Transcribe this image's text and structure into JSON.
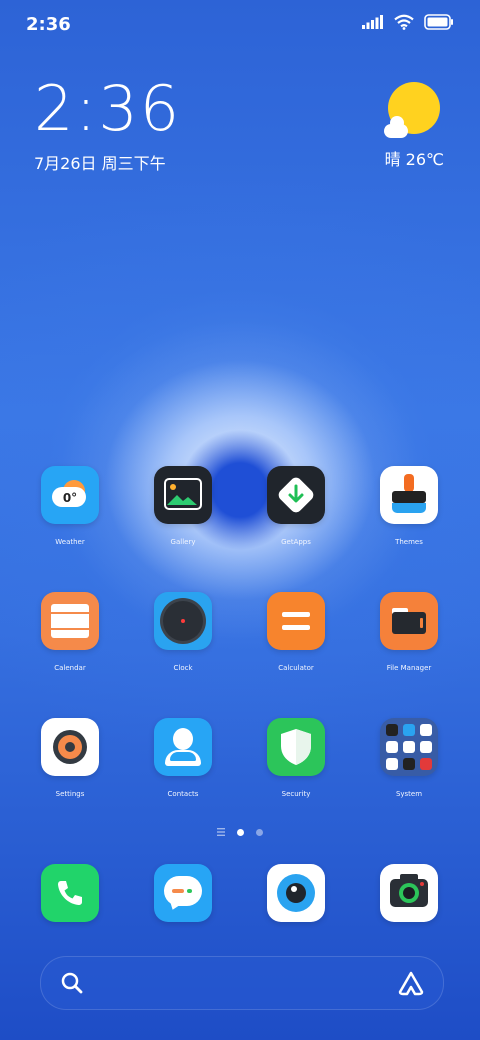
{
  "status_bar": {
    "time": "2:36"
  },
  "clock_widget": {
    "time": "2:36",
    "date": "7月26日 周三下午"
  },
  "weather_widget": {
    "text": "晴 26℃"
  },
  "apps": [
    {
      "label": "Weather",
      "icon": "weather-icon",
      "temp": "0°"
    },
    {
      "label": "Gallery",
      "icon": "gallery-icon"
    },
    {
      "label": "GetApps",
      "icon": "getapps-icon"
    },
    {
      "label": "Themes",
      "icon": "themes-icon"
    },
    {
      "label": "Calendar",
      "icon": "calendar-icon"
    },
    {
      "label": "Clock",
      "icon": "clock-icon"
    },
    {
      "label": "Calculator",
      "icon": "calculator-icon"
    },
    {
      "label": "File Manager",
      "icon": "file-manager-icon"
    },
    {
      "label": "Settings",
      "icon": "settings-icon"
    },
    {
      "label": "Contacts",
      "icon": "contacts-icon"
    },
    {
      "label": "Security",
      "icon": "security-icon"
    },
    {
      "label": "System",
      "icon": "system-folder-icon"
    }
  ],
  "dock": [
    {
      "icon": "phone-icon"
    },
    {
      "icon": "messages-icon"
    },
    {
      "icon": "browser-icon"
    },
    {
      "icon": "camera-icon"
    }
  ],
  "page_indicator": {
    "total_pages": 2,
    "current": 1
  },
  "colors": {
    "weather": "#27a5f5",
    "gallery": "#20252c",
    "getapps": "#20252c",
    "themes": "#ffffff",
    "calendar": "#f58a4a",
    "clock": "#2aa3f0",
    "calculator": "#f7842d",
    "file_manager": "#f5813a",
    "settings": "#ffffff",
    "contacts": "#27a5f5",
    "security": "#2cc55a",
    "phone": "#21d46a",
    "messages": "#27a5f5",
    "browser": "#ffffff",
    "camera": "#ffffff"
  }
}
